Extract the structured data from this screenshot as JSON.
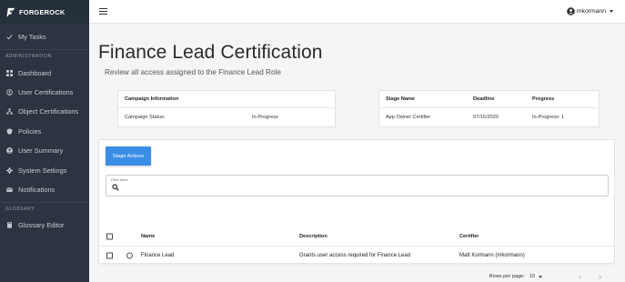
{
  "brand": {
    "name": "FORGEROCK"
  },
  "sidebar": {
    "top_items": [
      {
        "label": "My Tasks",
        "icon": "check-icon"
      }
    ],
    "sections": [
      {
        "title": "ADMINISTRATION",
        "items": [
          {
            "label": "Dashboard",
            "icon": "dashboard-icon"
          },
          {
            "label": "User Certifications",
            "icon": "user-cert-icon"
          },
          {
            "label": "Object Certifications",
            "icon": "object-cert-icon"
          },
          {
            "label": "Policies",
            "icon": "policy-icon"
          },
          {
            "label": "User Summary",
            "icon": "user-icon"
          },
          {
            "label": "System Settings",
            "icon": "gear-icon"
          },
          {
            "label": "Notifications",
            "icon": "mail-icon"
          }
        ]
      },
      {
        "title": "GLOSSARY",
        "items": [
          {
            "label": "Glossary Editor",
            "icon": "book-icon"
          }
        ]
      }
    ]
  },
  "topbar": {
    "username": "mkormann"
  },
  "page": {
    "title": "Finance Lead Certification",
    "subtitle": "Review all access assigned to the Finance Lead Role"
  },
  "campaign": {
    "header": "Campaign Information",
    "status_label": "Campaign Status:",
    "status_value": "In-Progress"
  },
  "stage": {
    "headers": {
      "name": "Stage Name",
      "deadline": "Deadline",
      "progress": "Progress"
    },
    "row": {
      "name": "App Owner Certifier",
      "deadline": "07/16/2020",
      "progress": "In-Progress: 1"
    }
  },
  "table": {
    "stage_actions_label": "Stage Actions",
    "filter_label": "Filter table",
    "filter_value": "",
    "headers": {
      "name": "Name",
      "description": "Description",
      "certifier": "Certifier"
    },
    "rows": [
      {
        "name": "Finance Lead",
        "description": "Grants user access required for Finance Lead",
        "certifier": "Matt Kormann (mkormann)"
      }
    ],
    "rows_per_page_label": "Rows per page:",
    "rows_per_page_value": "10",
    "pager_prev": "‹",
    "pager_next": "›"
  }
}
